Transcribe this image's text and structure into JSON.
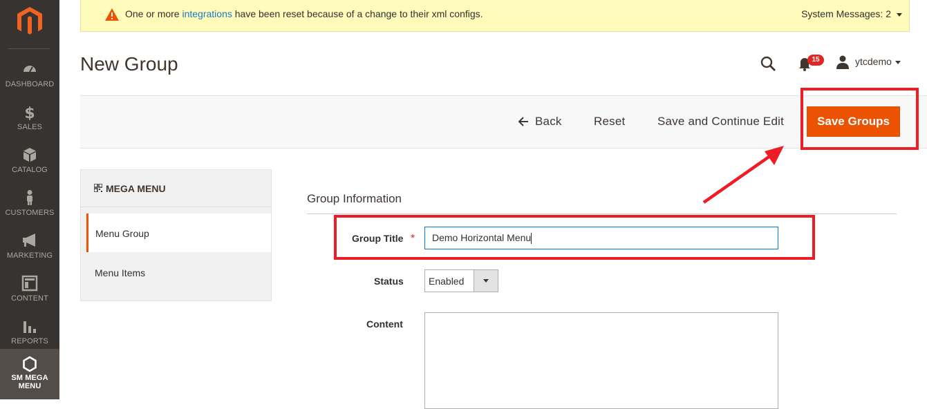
{
  "sidebar": {
    "items": [
      {
        "label": "DASHBOARD",
        "icon": "dashboard-icon"
      },
      {
        "label": "SALES",
        "icon": "dollar-icon"
      },
      {
        "label": "CATALOG",
        "icon": "box-icon"
      },
      {
        "label": "CUSTOMERS",
        "icon": "person-icon"
      },
      {
        "label": "MARKETING",
        "icon": "megaphone-icon"
      },
      {
        "label": "CONTENT",
        "icon": "layout-icon"
      },
      {
        "label": "REPORTS",
        "icon": "bar-chart-icon"
      },
      {
        "label_line1": "SM MEGA",
        "label_line2": "MENU",
        "icon": "hexagon-icon"
      }
    ]
  },
  "message": {
    "prefix": "One or more ",
    "link": "integrations",
    "suffix": " have been reset because of a change to their xml configs.",
    "system": "System Messages: 2"
  },
  "header": {
    "title": "New Group",
    "notifications_count": "15",
    "user": "ytcdemo"
  },
  "actions": {
    "back": "Back",
    "reset": "Reset",
    "save_continue": "Save and Continue Edit",
    "save": "Save Groups"
  },
  "tabs": {
    "heading": "MEGA MENU",
    "items": [
      "Menu Group",
      "Menu Items"
    ]
  },
  "form": {
    "section": "Group Information",
    "title_label": "Group Title",
    "title_value": "Demo Horizontal Menu",
    "status_label": "Status",
    "status_value": "Enabled",
    "content_label": "Content",
    "content_value": ""
  },
  "colors": {
    "accent": "#eb5202",
    "sidebar": "#373330",
    "annotation": "#ee1c24",
    "message_bg": "#fffbbb",
    "link": "#1979c3"
  }
}
